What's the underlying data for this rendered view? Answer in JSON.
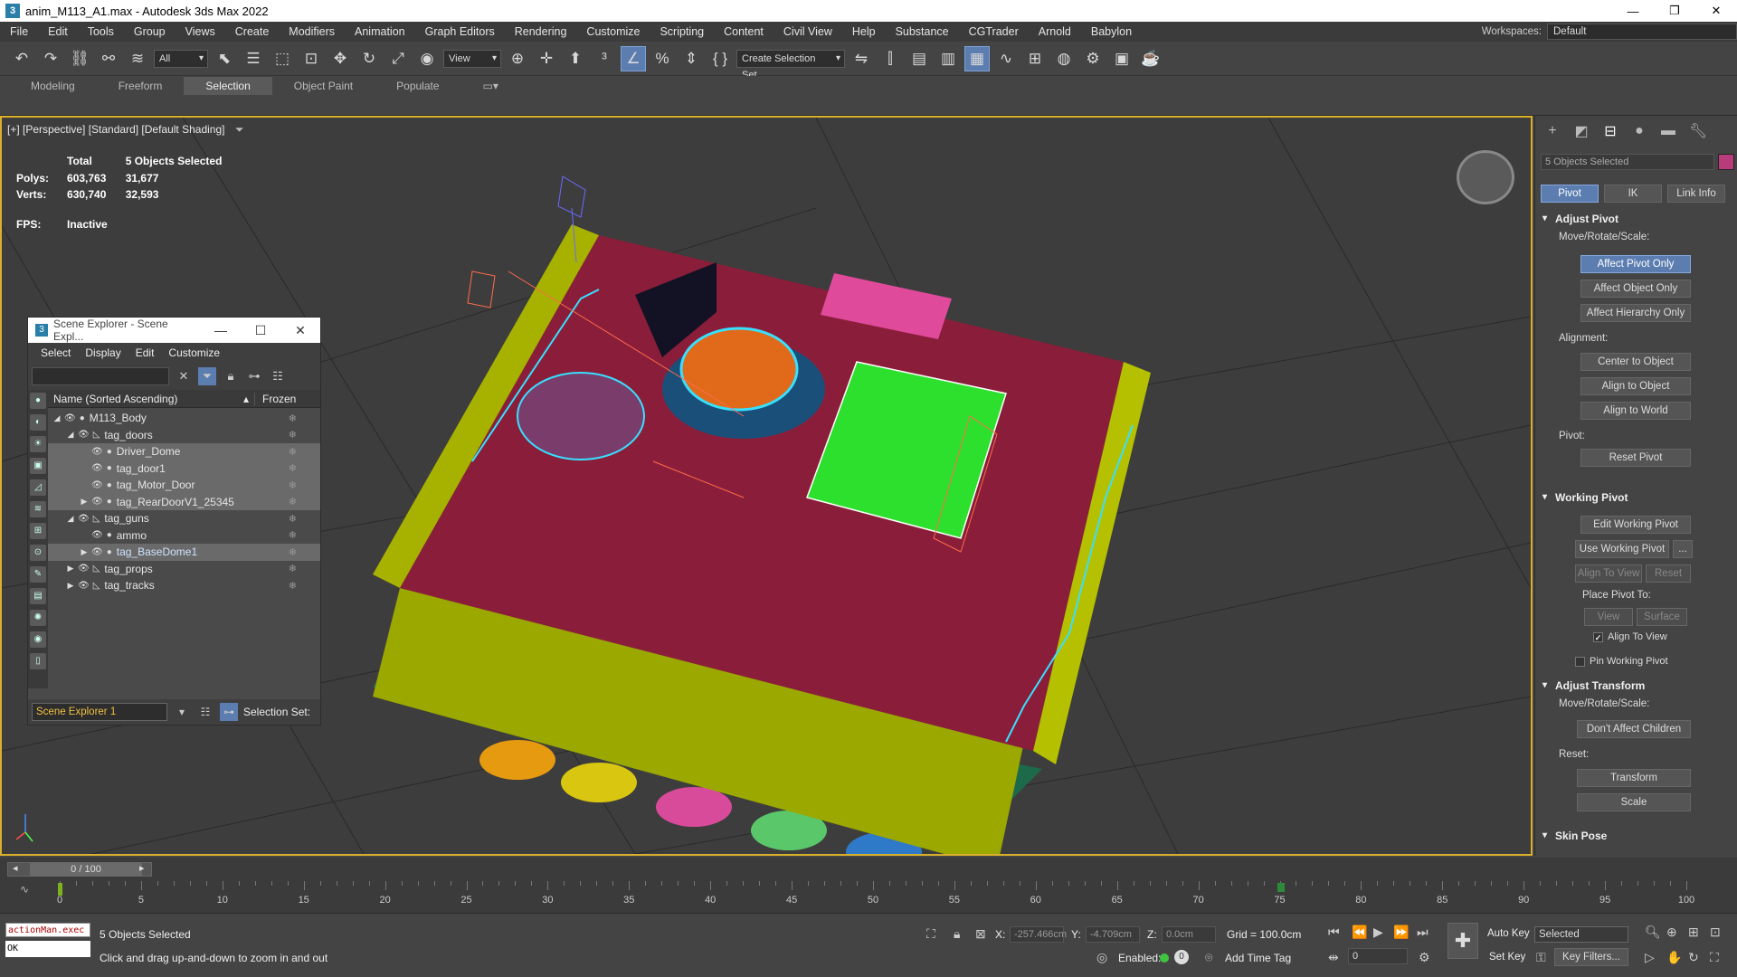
{
  "window": {
    "title": "anim_M113_A1.max - Autodesk 3ds Max 2022",
    "app_icon": "3",
    "controls": [
      "—",
      "❐",
      "✕"
    ]
  },
  "menu": [
    "File",
    "Edit",
    "Tools",
    "Group",
    "Views",
    "Create",
    "Modifiers",
    "Animation",
    "Graph Editors",
    "Rendering",
    "Customize",
    "Scripting",
    "Content",
    "Civil View",
    "Help",
    "Substance",
    "CGTrader",
    "Arnold",
    "Babylon"
  ],
  "workspaces": {
    "label": "Workspaces:",
    "value": "Default"
  },
  "toolbar": {
    "filter": "All",
    "view": "View",
    "selection_set": "Create Selection Set"
  },
  "ribbon": {
    "tabs": [
      "Modeling",
      "Freeform",
      "Selection",
      "Object Paint",
      "Populate"
    ],
    "active": "Selection"
  },
  "viewport": {
    "label": "[+] [Perspective] [Standard] [Default Shading]",
    "stats": {
      "total": "Total",
      "selected": "5 Objects Selected",
      "polys_label": "Polys:",
      "polys_total": "603,763",
      "polys_sel": "31,677",
      "verts_label": "Verts:",
      "verts_total": "630,740",
      "verts_sel": "32,593",
      "fps_label": "FPS:",
      "fps": "Inactive"
    },
    "colors": {
      "hull_top": "#8a1e3a",
      "hull_side": "#9aa800",
      "green_hatch": "#2ee02e",
      "orange_dome": "#e06a1a",
      "pink_boxes": "#e04a9a",
      "selection": "#38e0ff"
    }
  },
  "scene_explorer": {
    "title": "Scene Explorer - Scene Expl...",
    "icon": "3",
    "controls": [
      "—",
      "☐",
      "✕"
    ],
    "menu": [
      "Select",
      "Display",
      "Edit",
      "Customize"
    ],
    "col_name": "Name (Sorted Ascending)",
    "col_frozen": "Frozen",
    "rows": [
      {
        "name": "M113_Body",
        "depth": 0,
        "arrow": "◢",
        "sel": false
      },
      {
        "name": "tag_doors",
        "depth": 1,
        "arrow": "◢",
        "sel": false
      },
      {
        "name": "Driver_Dome",
        "depth": 2,
        "arrow": "",
        "sel": true
      },
      {
        "name": "tag_door1",
        "depth": 2,
        "arrow": "",
        "sel": true
      },
      {
        "name": "tag_Motor_Door",
        "depth": 2,
        "arrow": "",
        "sel": true
      },
      {
        "name": "tag_RearDoorV1_25345",
        "depth": 2,
        "arrow": "▶",
        "sel": true
      },
      {
        "name": "tag_guns",
        "depth": 1,
        "arrow": "◢",
        "sel": false
      },
      {
        "name": "ammo",
        "depth": 2,
        "arrow": "",
        "sel": false
      },
      {
        "name": "tag_BaseDome1",
        "depth": 2,
        "arrow": "▶",
        "sel": true,
        "hl": true
      },
      {
        "name": "tag_props",
        "depth": 1,
        "arrow": "▶",
        "sel": false
      },
      {
        "name": "tag_tracks",
        "depth": 1,
        "arrow": "▶",
        "sel": false
      }
    ],
    "footer_dropdown": "Scene Explorer 1",
    "selection_set_label": "Selection Set:"
  },
  "command_panel": {
    "object_field": "5 Objects Selected",
    "subtabs": [
      "Pivot",
      "IK",
      "Link Info"
    ],
    "active_subtab": "Pivot",
    "adjust_pivot": {
      "title": "Adjust Pivot",
      "mrs": "Move/Rotate/Scale:",
      "buttons": [
        "Affect Pivot Only",
        "Affect Object Only",
        "Affect Hierarchy Only"
      ],
      "alignment": "Alignment:",
      "align_buttons": [
        "Center to Object",
        "Align to Object",
        "Align to World"
      ],
      "pivot": "Pivot:",
      "reset": "Reset Pivot"
    },
    "working_pivot": {
      "title": "Working Pivot",
      "edit": "Edit Working Pivot",
      "use": "Use Working Pivot",
      "dots": "...",
      "align_view": "Align To View",
      "reset": "Reset",
      "place": "Place Pivot To:",
      "view": "View",
      "surface": "Surface",
      "align_to_view_chk": "Align To View",
      "pin": "Pin Working Pivot"
    },
    "adjust_transform": {
      "title": "Adjust Transform",
      "mrs": "Move/Rotate/Scale:",
      "dont": "Don't Affect Children",
      "reset": "Reset:",
      "transform": "Transform",
      "scale": "Scale"
    },
    "skin_pose": "Skin Pose"
  },
  "timeline": {
    "position": "0 / 100",
    "ticks": [
      "0",
      "5",
      "10",
      "15",
      "20",
      "25",
      "30",
      "35",
      "40",
      "45",
      "50",
      "55",
      "60",
      "65",
      "70",
      "75",
      "80",
      "85",
      "90",
      "95",
      "100"
    ]
  },
  "status": {
    "maxscript": "actionMan.exec",
    "maxscript_out": "OK",
    "selected": "5 Objects Selected",
    "prompt": "Click and drag up-and-down to zoom in and out",
    "x_label": "X:",
    "x_value": "-257.466cm",
    "y_label": "Y:",
    "y_value": "-4.709cm",
    "z_label": "Z:",
    "z_value": "0.0cm",
    "grid": "Grid = 100.0cm",
    "enabled": "Enabled:",
    "add_time_tag": "Add Time Tag",
    "auto_key": "Auto Key",
    "set_key": "Set Key",
    "key_mode": "Selected",
    "frame": "0",
    "key_filters": "Key Filters..."
  }
}
